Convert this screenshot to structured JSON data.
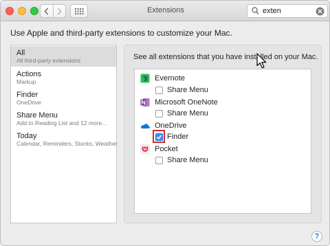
{
  "window": {
    "title": "Extensions",
    "search": {
      "value": "exten",
      "placeholder": "Search"
    }
  },
  "intro_text": "Use Apple and third-party extensions to customize your Mac.",
  "sidebar": {
    "items": [
      {
        "title": "All",
        "subtitle": "All third-party extensions",
        "selected": true
      },
      {
        "title": "Actions",
        "subtitle": "Markup",
        "selected": false
      },
      {
        "title": "Finder",
        "subtitle": "OneDrive",
        "selected": false
      },
      {
        "title": "Share Menu",
        "subtitle": "Add to Reading List and 12 more...",
        "selected": false
      },
      {
        "title": "Today",
        "subtitle": "Calendar, Reminders, Stocks, Weather",
        "selected": false
      }
    ]
  },
  "main": {
    "header": "See all extensions that you have installed on your Mac.",
    "apps": [
      {
        "name": "Evernote",
        "icon": "evernote-icon",
        "color": "#2dbe60",
        "extensions": [
          {
            "label": "Share Menu",
            "checked": false
          }
        ]
      },
      {
        "name": "Microsoft OneNote",
        "icon": "onenote-icon",
        "color": "#7b3fa8",
        "extensions": [
          {
            "label": "Share Menu",
            "checked": false
          }
        ]
      },
      {
        "name": "OneDrive",
        "icon": "onedrive-icon",
        "color": "#1677d4",
        "extensions": [
          {
            "label": "Finder",
            "checked": true,
            "highlighted": true
          }
        ]
      },
      {
        "name": "Pocket",
        "icon": "pocket-icon",
        "color": "#ef4056",
        "extensions": [
          {
            "label": "Share Menu",
            "checked": false
          }
        ]
      }
    ]
  },
  "help_label": "?",
  "colors": {
    "highlight": "#d22a2a",
    "checkbox_on": "#3b8ff0"
  }
}
